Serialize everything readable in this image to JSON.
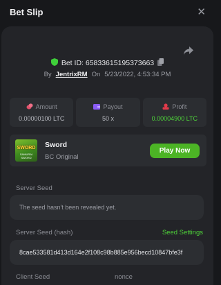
{
  "header": {
    "title": "Bet Slip",
    "close_label": "✕"
  },
  "bet": {
    "id_label": "Bet ID: 65833615195373663",
    "by_label": "By",
    "username": "JentrixRM",
    "on_label": "On",
    "timestamp": "5/23/2022, 4:53:34 PM"
  },
  "stats": [
    {
      "label": "Amount",
      "value": "0.00000100 LTC",
      "icon": "coins-icon",
      "color": "#e0516a"
    },
    {
      "label": "Payout",
      "value": "50 x",
      "icon": "wallet-icon",
      "color": "#8a5cf6"
    },
    {
      "label": "Profit",
      "value": "0.00004900 LTC",
      "icon": "profit-icon",
      "color": "#e23a4a"
    }
  ],
  "game": {
    "name": "Sword",
    "type": "BC Original",
    "thumb_title": "SWORD",
    "thumb_sub": "SAMURAI SWORD",
    "play_label": "Play Now"
  },
  "server_seed": {
    "label": "Server Seed",
    "value": "The seed hasn't been revealed yet."
  },
  "server_seed_hash": {
    "label": "Server Seed (hash)",
    "settings_link": "Seed Settings",
    "value": "8cae533581d413d164e2f108c98b885e956becd10847bfe3f"
  },
  "client_seed": {
    "label": "Client Seed"
  },
  "nonce": {
    "label": "nonce"
  },
  "colors": {
    "accent_green": "#4cb425",
    "profit_green": "#4fd53a",
    "panel": "#232428",
    "background": "#17181b"
  }
}
